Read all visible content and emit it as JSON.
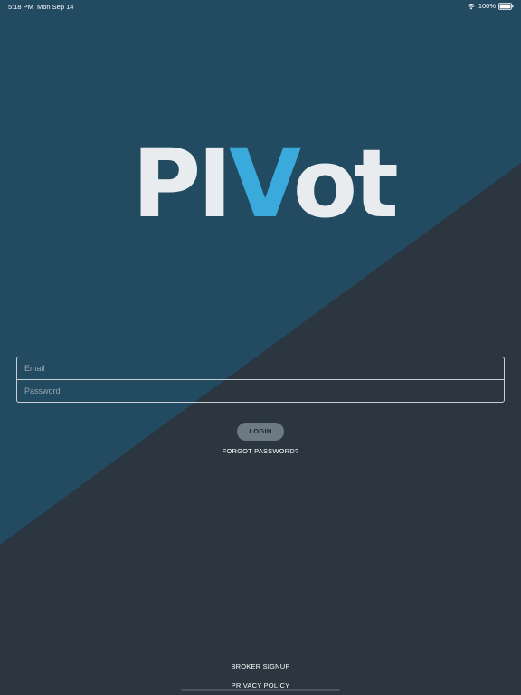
{
  "status_bar": {
    "time": "5:18 PM",
    "date": "Mon Sep 14",
    "battery": "100%"
  },
  "logo": {
    "part1": "PI",
    "part2": "V",
    "part3": "ot"
  },
  "form": {
    "email_placeholder": "Email",
    "password_placeholder": "Password",
    "login_label": "LOGIN",
    "forgot_label": "FORGOT PASSWORD?"
  },
  "footer": {
    "broker_signup_label": "BROKER SIGNUP",
    "privacy_policy_label": "PRIVACY POLICY"
  },
  "colors": {
    "background_dark": "#2b3640",
    "background_blue": "#224a60",
    "logo_white": "#e8ecee",
    "logo_accent": "#3aa9dc",
    "button_bg": "#6e7a83"
  }
}
